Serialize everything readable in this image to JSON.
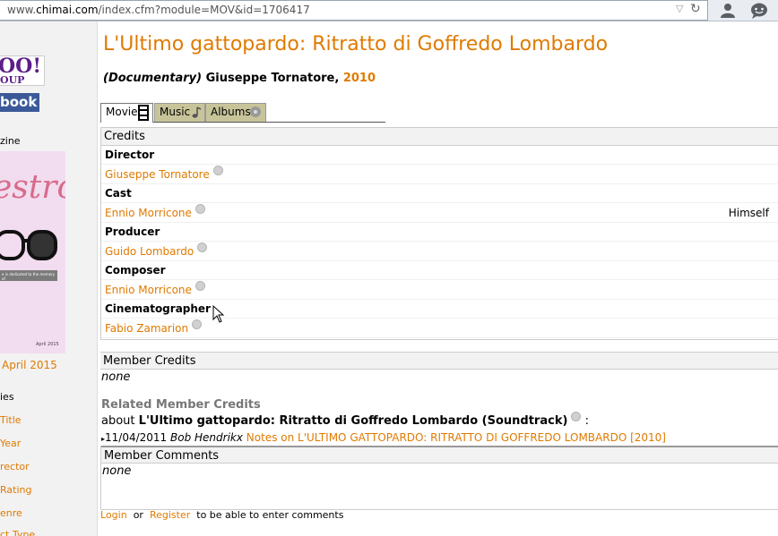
{
  "browser": {
    "url_prefix": "www.",
    "url_host": "chimai.com",
    "url_path": "/index.cfm?module=MOV&id=1706417",
    "dropdown_glyph": "▽",
    "reload_glyph": "↻"
  },
  "sidebar": {
    "yahoo_text": "OO!",
    "yahoo_sub": "OUP",
    "facebook_text": "book",
    "magazine_label": "zine",
    "magazine_cover_title": "estro",
    "magazine_cover_bar": "e is dedicated to the memory of",
    "magazine_cover_month": "April 2015",
    "magazine_date": "April 2015",
    "categories_label": "ies",
    "links": [
      "Title",
      "Year",
      "rector",
      "Rating",
      "enre",
      "ct Type"
    ]
  },
  "page": {
    "title": "L'Ultimo gattopardo: Ritratto di Goffredo Lombardo",
    "genre": "(Documentary)",
    "director_name": "Giuseppe Tornatore,",
    "year": "2010"
  },
  "tabs": [
    {
      "label": "Movie"
    },
    {
      "label": "Music"
    },
    {
      "label": "Albums"
    }
  ],
  "credits": {
    "header": "Credits",
    "rows": [
      {
        "role": "Director",
        "name": "Giuseppe Tornatore",
        "part": ""
      },
      {
        "role": "Cast",
        "name": "Ennio Morricone",
        "part": "Himself"
      },
      {
        "role": "Producer",
        "name": "Guido Lombardo",
        "part": ""
      },
      {
        "role": "Composer",
        "name": "Ennio Morricone",
        "part": ""
      },
      {
        "role": "Cinematographer",
        "name": "Fabio Zamarion",
        "part": ""
      }
    ]
  },
  "member_credits": {
    "header": "Member Credits",
    "value": "none"
  },
  "related": {
    "title": "Related Member Credits",
    "about_prefix": "about",
    "about_title": "L'Ultimo gattopardo: Ritratto di Goffredo Lombardo (Soundtrack)",
    "about_suffix": ":",
    "note_date": "11/04/2011",
    "note_author": "Bob Hendrikx",
    "note_link": "Notes on L'ULTIMO GATTOPARDO: RITRATTO DI GOFFREDO LOMBARDO [2010]"
  },
  "member_comments": {
    "header": "Member Comments",
    "value": "none"
  },
  "login": {
    "login_label": "Login",
    "or_label": "or",
    "register_label": "Register",
    "suffix": "to be able to enter comments"
  },
  "colors": {
    "accent": "#e07a00",
    "tab_inactive": "#c8c49a"
  }
}
